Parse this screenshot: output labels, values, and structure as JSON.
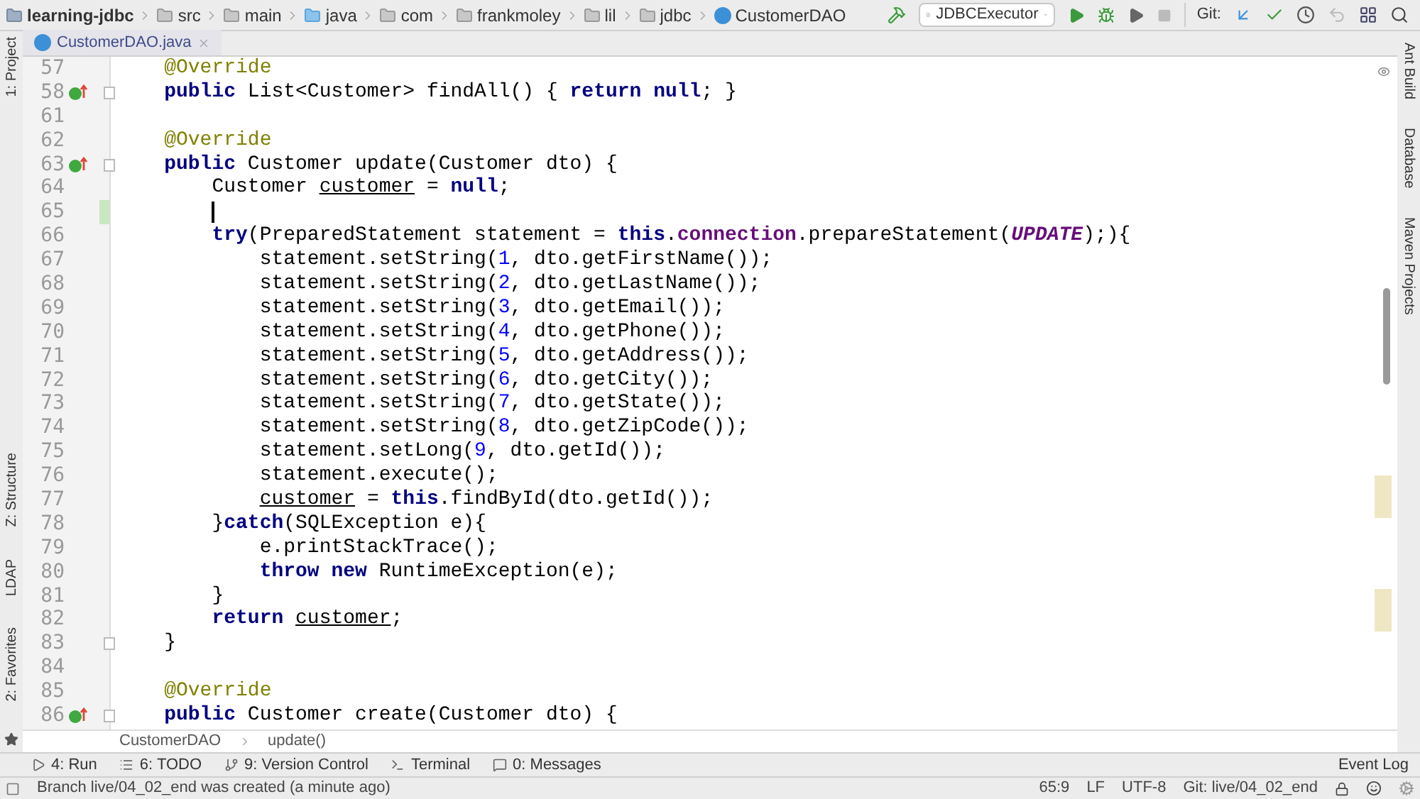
{
  "breadcrumbs": [
    {
      "label": "learning-jdbc",
      "kind": "module"
    },
    {
      "label": "src",
      "kind": "folder"
    },
    {
      "label": "main",
      "kind": "folder"
    },
    {
      "label": "java",
      "kind": "source"
    },
    {
      "label": "com",
      "kind": "package"
    },
    {
      "label": "frankmoley",
      "kind": "package"
    },
    {
      "label": "lil",
      "kind": "package"
    },
    {
      "label": "jdbc",
      "kind": "package"
    },
    {
      "label": "CustomerDAO",
      "kind": "class"
    }
  ],
  "toolbar": {
    "run_config": "JDBCExecutor",
    "git_label": "Git:"
  },
  "tabs": [
    {
      "label": "CustomerDAO.java",
      "selected": true
    }
  ],
  "left_tools": [
    {
      "label": "1: Project"
    },
    {
      "label": "Z: Structure"
    },
    {
      "label": "LDAP"
    },
    {
      "label": "2: Favorites"
    }
  ],
  "right_tools": [
    {
      "label": "Ant Build"
    },
    {
      "label": "Database"
    },
    {
      "label": "Maven Projects"
    }
  ],
  "lines": [
    {
      "number": "57",
      "override": false,
      "fold": false,
      "changed": false,
      "caret": false,
      "tokens": [
        {
          "text": "    @Override",
          "kind": "annotation"
        }
      ]
    },
    {
      "number": "58",
      "override": true,
      "fold": true,
      "changed": false,
      "caret": false,
      "tokens": [
        {
          "text": "    public",
          "kind": "keyword"
        },
        {
          "text": " List<Customer> findAll() { ",
          "kind": "plain"
        },
        {
          "text": "return",
          "kind": "keyword"
        },
        {
          "text": " null",
          "kind": "keyword"
        },
        {
          "text": "; }",
          "kind": "plain"
        }
      ]
    },
    {
      "number": "61",
      "override": false,
      "fold": false,
      "changed": false,
      "caret": false
    },
    {
      "number": "62",
      "override": false,
      "fold": false,
      "changed": false,
      "caret": false,
      "tokens": [
        {
          "text": "    @Override",
          "kind": "annotation"
        }
      ]
    },
    {
      "number": "63",
      "override": true,
      "fold": true,
      "changed": false,
      "caret": false,
      "tokens": [
        {
          "text": "    public",
          "kind": "keyword"
        },
        {
          "text": " Customer update(Customer dto) {",
          "kind": "plain"
        }
      ]
    },
    {
      "number": "64",
      "override": false,
      "fold": false,
      "changed": false,
      "caret": false,
      "tokens": [
        {
          "text": "        Customer ",
          "kind": "plain"
        },
        {
          "text": "customer",
          "kind": "reassigned"
        },
        {
          "text": " = ",
          "kind": "plain"
        },
        {
          "text": "null",
          "kind": "keyword"
        },
        {
          "text": ";",
          "kind": "plain"
        }
      ]
    },
    {
      "number": "65",
      "override": false,
      "fold": false,
      "changed": true,
      "caret": true
    },
    {
      "number": "66",
      "override": false,
      "fold": false,
      "changed": false,
      "caret": false,
      "tokens": [
        {
          "text": "        try",
          "kind": "keyword"
        },
        {
          "text": "(PreparedStatement statement = ",
          "kind": "plain"
        },
        {
          "text": "this",
          "kind": "keyword"
        },
        {
          "text": ".",
          "kind": "plain"
        },
        {
          "text": "connection",
          "kind": "field"
        },
        {
          "text": ".prepareStatement(",
          "kind": "plain"
        },
        {
          "text": "UPDATE",
          "kind": "constant"
        },
        {
          "text": ");){",
          "kind": "plain"
        }
      ]
    },
    {
      "number": "67",
      "override": false,
      "fold": false,
      "changed": false,
      "caret": false,
      "tokens": [
        {
          "text": "            statement.setString(",
          "kind": "plain"
        },
        {
          "text": "1",
          "kind": "number"
        },
        {
          "text": ", dto.getFirstName());",
          "kind": "plain"
        }
      ]
    },
    {
      "number": "68",
      "override": false,
      "fold": false,
      "changed": false,
      "caret": false,
      "tokens": [
        {
          "text": "            statement.setString(",
          "kind": "plain"
        },
        {
          "text": "2",
          "kind": "number"
        },
        {
          "text": ", dto.getLastName());",
          "kind": "plain"
        }
      ]
    },
    {
      "number": "69",
      "override": false,
      "fold": false,
      "changed": false,
      "caret": false,
      "tokens": [
        {
          "text": "            statement.setString(",
          "kind": "plain"
        },
        {
          "text": "3",
          "kind": "number"
        },
        {
          "text": ", dto.getEmail());",
          "kind": "plain"
        }
      ]
    },
    {
      "number": "70",
      "override": false,
      "fold": false,
      "changed": false,
      "caret": false,
      "tokens": [
        {
          "text": "            statement.setString(",
          "kind": "plain"
        },
        {
          "text": "4",
          "kind": "number"
        },
        {
          "text": ", dto.getPhone());",
          "kind": "plain"
        }
      ]
    },
    {
      "number": "71",
      "override": false,
      "fold": false,
      "changed": false,
      "caret": false,
      "tokens": [
        {
          "text": "            statement.setString(",
          "kind": "plain"
        },
        {
          "text": "5",
          "kind": "number"
        },
        {
          "text": ", dto.getAddress());",
          "kind": "plain"
        }
      ]
    },
    {
      "number": "72",
      "override": false,
      "fold": false,
      "changed": false,
      "caret": false,
      "tokens": [
        {
          "text": "            statement.setString(",
          "kind": "plain"
        },
        {
          "text": "6",
          "kind": "number"
        },
        {
          "text": ", dto.getCity());",
          "kind": "plain"
        }
      ]
    },
    {
      "number": "73",
      "override": false,
      "fold": false,
      "changed": false,
      "caret": false,
      "tokens": [
        {
          "text": "            statement.setString(",
          "kind": "plain"
        },
        {
          "text": "7",
          "kind": "number"
        },
        {
          "text": ", dto.getState());",
          "kind": "plain"
        }
      ]
    },
    {
      "number": "74",
      "override": false,
      "fold": false,
      "changed": false,
      "caret": false,
      "tokens": [
        {
          "text": "            statement.setString(",
          "kind": "plain"
        },
        {
          "text": "8",
          "kind": "number"
        },
        {
          "text": ", dto.getZipCode());",
          "kind": "plain"
        }
      ]
    },
    {
      "number": "75",
      "override": false,
      "fold": false,
      "changed": false,
      "caret": false,
      "tokens": [
        {
          "text": "            statement.setLong(",
          "kind": "plain"
        },
        {
          "text": "9",
          "kind": "number"
        },
        {
          "text": ", dto.getId());",
          "kind": "plain"
        }
      ]
    },
    {
      "number": "76",
      "override": false,
      "fold": false,
      "changed": false,
      "caret": false,
      "tokens": [
        {
          "text": "            statement.execute();",
          "kind": "plain"
        }
      ]
    },
    {
      "number": "77",
      "override": false,
      "fold": false,
      "changed": false,
      "caret": false,
      "tokens": [
        {
          "text": "            customer",
          "kind": "reassigned"
        },
        {
          "text": " = ",
          "kind": "plain"
        },
        {
          "text": "this",
          "kind": "keyword"
        },
        {
          "text": ".findById(dto.getId());",
          "kind": "plain"
        }
      ]
    },
    {
      "number": "78",
      "override": false,
      "fold": false,
      "changed": false,
      "caret": false,
      "tokens": [
        {
          "text": "        }",
          "kind": "plain"
        },
        {
          "text": "catch",
          "kind": "keyword"
        },
        {
          "text": "(SQLException e){",
          "kind": "plain"
        }
      ]
    },
    {
      "number": "79",
      "override": false,
      "fold": false,
      "changed": false,
      "caret": false,
      "tokens": [
        {
          "text": "            e.printStackTrace();",
          "kind": "plain"
        }
      ]
    },
    {
      "number": "80",
      "override": false,
      "fold": false,
      "changed": false,
      "caret": false,
      "tokens": [
        {
          "text": "            throw new",
          "kind": "keyword"
        },
        {
          "text": " RuntimeException(e);",
          "kind": "plain"
        }
      ]
    },
    {
      "number": "81",
      "override": false,
      "fold": false,
      "changed": false,
      "caret": false,
      "tokens": [
        {
          "text": "        }",
          "kind": "plain"
        }
      ]
    },
    {
      "number": "82",
      "override": false,
      "fold": false,
      "changed": false,
      "caret": false,
      "tokens": [
        {
          "text": "        return",
          "kind": "keyword"
        },
        {
          "text": " customer",
          "kind": "reassigned"
        },
        {
          "text": ";",
          "kind": "plain"
        }
      ]
    },
    {
      "number": "83",
      "override": false,
      "fold": true,
      "changed": false,
      "caret": false,
      "tokens": [
        {
          "text": "    }",
          "kind": "plain"
        }
      ]
    },
    {
      "number": "84",
      "override": false,
      "fold": false,
      "changed": false,
      "caret": false
    },
    {
      "number": "85",
      "override": false,
      "fold": false,
      "changed": false,
      "caret": false,
      "tokens": [
        {
          "text": "    @Override",
          "kind": "annotation"
        }
      ]
    },
    {
      "number": "86",
      "override": true,
      "fold": true,
      "changed": false,
      "caret": false,
      "tokens": [
        {
          "text": "    public",
          "kind": "keyword"
        },
        {
          "text": " Customer create(Customer dto) {",
          "kind": "plain"
        }
      ]
    }
  ],
  "editor_breadcrumbs": [
    "CustomerDAO",
    "update()"
  ],
  "tool_windows": [
    {
      "label": "4: Run",
      "kind": "run"
    },
    {
      "label": "6: TODO",
      "kind": "todo"
    },
    {
      "label": "9: Version Control",
      "kind": "vcs"
    },
    {
      "label": "Terminal",
      "kind": "terminal"
    },
    {
      "label": "0: Messages",
      "kind": "messages"
    }
  ],
  "event_log": "Event Log",
  "status_bar": {
    "message": "Branch live/04_02_end was created (a minute ago)",
    "position": "65:9",
    "line_separator": "LF",
    "encoding": "UTF-8",
    "git_branch": "Git: live/04_02_end"
  }
}
